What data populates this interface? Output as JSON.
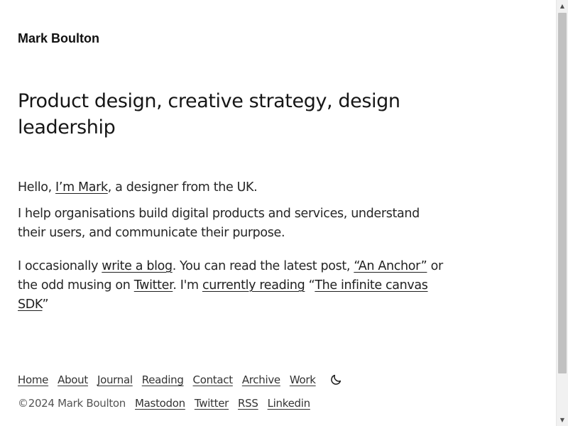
{
  "header": {
    "site_title": "Mark Boulton"
  },
  "hero": {
    "headline": "Product design, creative strategy, design leadership"
  },
  "intro": {
    "p1": {
      "before": "Hello, ",
      "link": "I’m Mark",
      "after": ", a designer from the UK."
    },
    "p2": "I help organisations build digital products and services, understand their users, and communicate their purpose.",
    "p3": {
      "t1": "I occasionally ",
      "blog_link": "write a blog",
      "t2": ". You can read the latest post, ",
      "post_link": "“An Anchor”",
      "t3": " or the odd musing on ",
      "twitter_link": "Twitter",
      "t4": ". I'm ",
      "reading_link": "currently reading",
      "t5": " “",
      "book_link": "The infinite canvas SDK",
      "t6": "”"
    }
  },
  "nav": {
    "items": [
      {
        "label": "Home"
      },
      {
        "label": "About"
      },
      {
        "label": "Journal"
      },
      {
        "label": "Reading"
      },
      {
        "label": "Contact"
      },
      {
        "label": "Archive"
      },
      {
        "label": "Work"
      }
    ],
    "theme_toggle_icon": "moon-icon"
  },
  "footer": {
    "copyright": "©2024 Mark Boulton",
    "links": [
      {
        "label": "Mastodon"
      },
      {
        "label": "Twitter"
      },
      {
        "label": "RSS"
      },
      {
        "label": "Linkedin"
      }
    ]
  },
  "colors": {
    "background": "#ffffff",
    "text": "#1f1f1f",
    "muted": "#555555"
  }
}
